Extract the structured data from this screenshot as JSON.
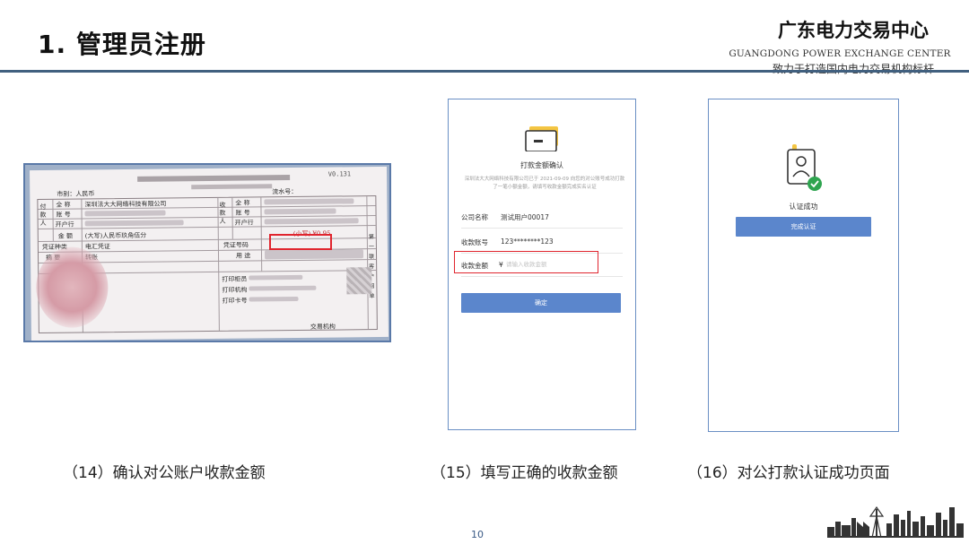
{
  "header": {
    "title": "1. 管理员注册",
    "brand_cn": "广东电力交易中心",
    "brand_en": "GUANGDONG POWER EXCHANGE CENTER",
    "slogan": "致力于打造国内电力交易机构标杆"
  },
  "receipt": {
    "serial": "V0.131",
    "payer_city": "市别：人民币",
    "flow_no": "流水号：",
    "payer_label": "付款人",
    "payee_label": "收款人",
    "fullname_label": "全 称",
    "account_label": "账 号",
    "bank_label": "开户行",
    "payer_name": "深圳法大大网络科技有限公司",
    "amount_label": "金 额",
    "amount_words": "(大写)人民币玖角伍分",
    "amount_small": "(小写) ¥0.95",
    "voucher_type_label": "凭证种类",
    "voucher_type": "电汇凭证",
    "voucher_no_label": "凭证号码",
    "summary_label": "摘 要",
    "summary": "转账",
    "usage_label": "用 途",
    "print_counter": "打印柜员",
    "print_org": "打印机构",
    "print_card": "打印卡号",
    "side_text": "第一联 客户回单",
    "bottom_org": "交易机构"
  },
  "payment_confirm": {
    "title": "打款金额确认",
    "note": "深圳法大大网络科技有限公司已于 2021-09-09 向您的对公账号成功打款了一笔小额金额，请填写收款金额完成实名认证",
    "company_label": "公司名称",
    "company_value": "测试用户00017",
    "account_label": "收款账号",
    "account_value": "123********123",
    "amount_label": "收款金额",
    "currency": "¥",
    "amount_placeholder": "请输入收款金额",
    "confirm_button": "确定"
  },
  "auth_success": {
    "title": "认证成功",
    "finish_button": "完成认证"
  },
  "captions": {
    "c14": "（14）确认对公账户收款金额",
    "c15": "（15）填写正确的收款金额",
    "c16": "（16）对公打款认证成功页面"
  },
  "page_number": "10",
  "colors": {
    "accent_blue": "#5b86cc",
    "highlight_red": "#e0252e",
    "header_rule": "#41607f",
    "success_green": "#2ea44f"
  }
}
